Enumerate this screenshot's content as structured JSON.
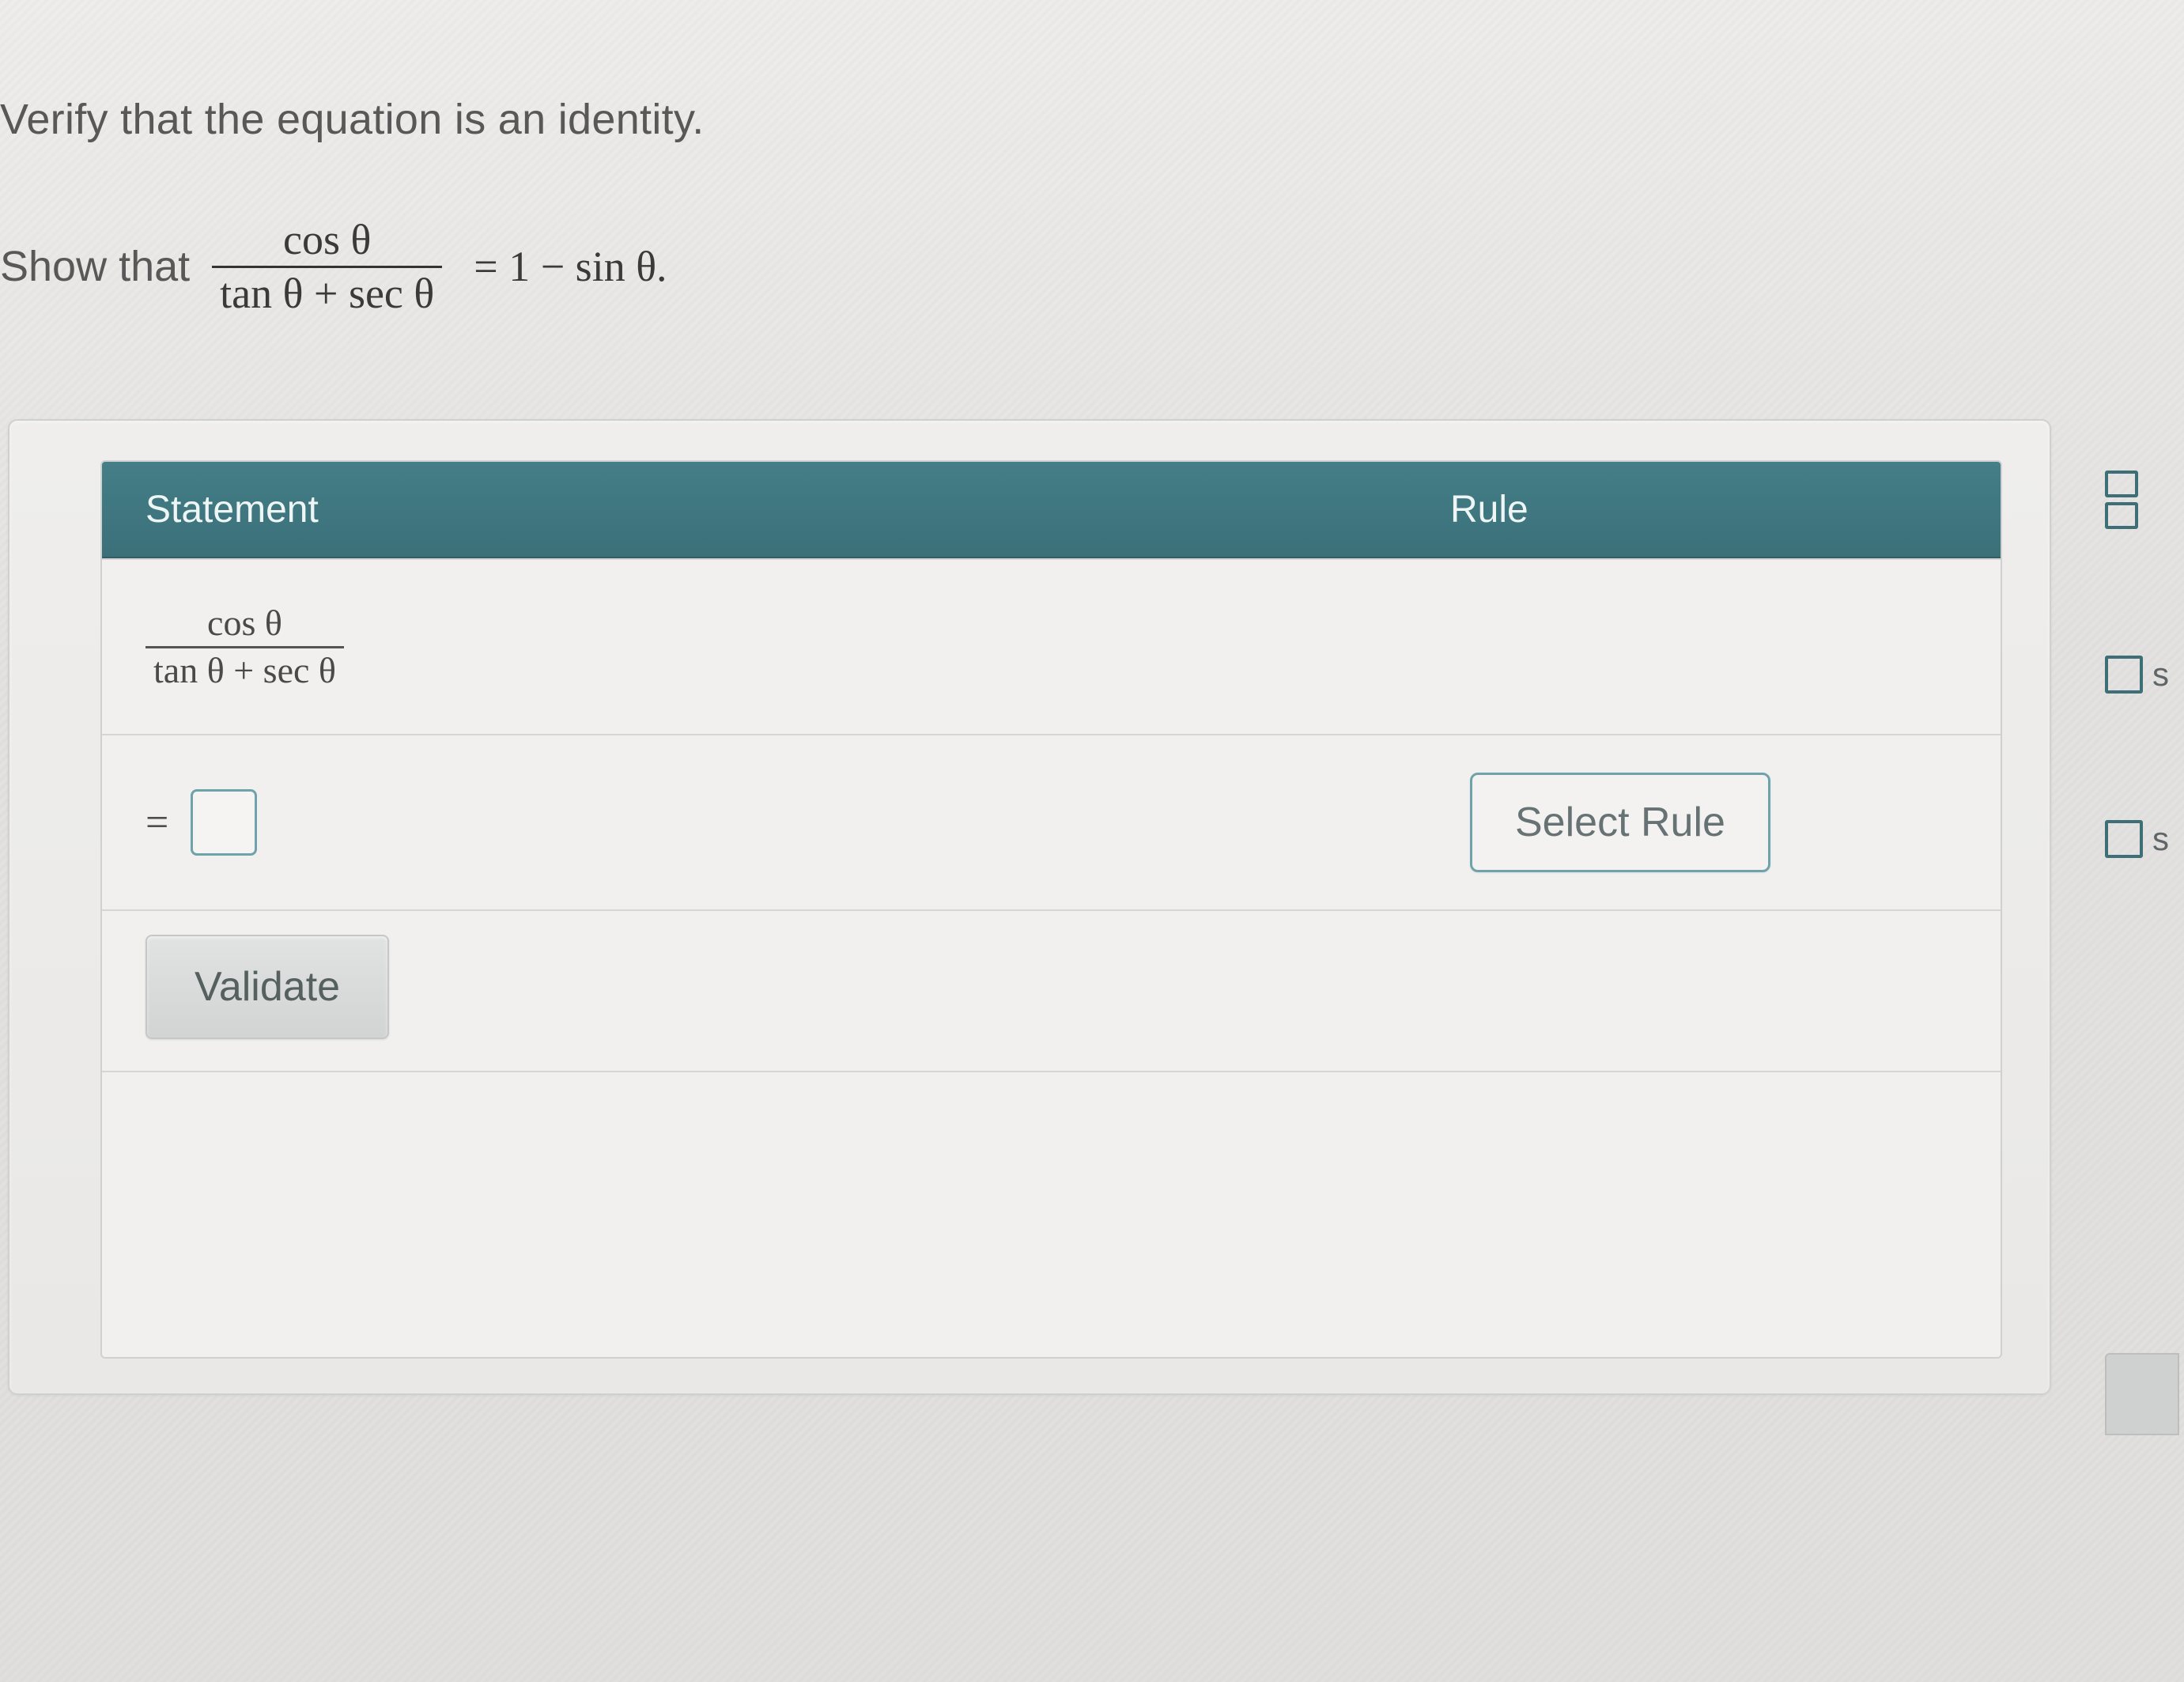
{
  "prompt": "Verify that the equation is an identity.",
  "show_that_label": "Show that",
  "equation": {
    "lhs_num": "cos θ",
    "lhs_den": "tan θ + sec θ",
    "rhs": "= 1 − sin θ."
  },
  "table": {
    "headers": {
      "statement": "Statement",
      "rule": "Rule"
    },
    "row1": {
      "frac_num": "cos θ",
      "frac_den": "tan θ  +  sec θ"
    },
    "row2": {
      "equals": "=",
      "select_rule": "Select Rule"
    },
    "validate": "Validate"
  },
  "sidebar": {
    "item2_suffix": "s",
    "item3_suffix": "s"
  }
}
